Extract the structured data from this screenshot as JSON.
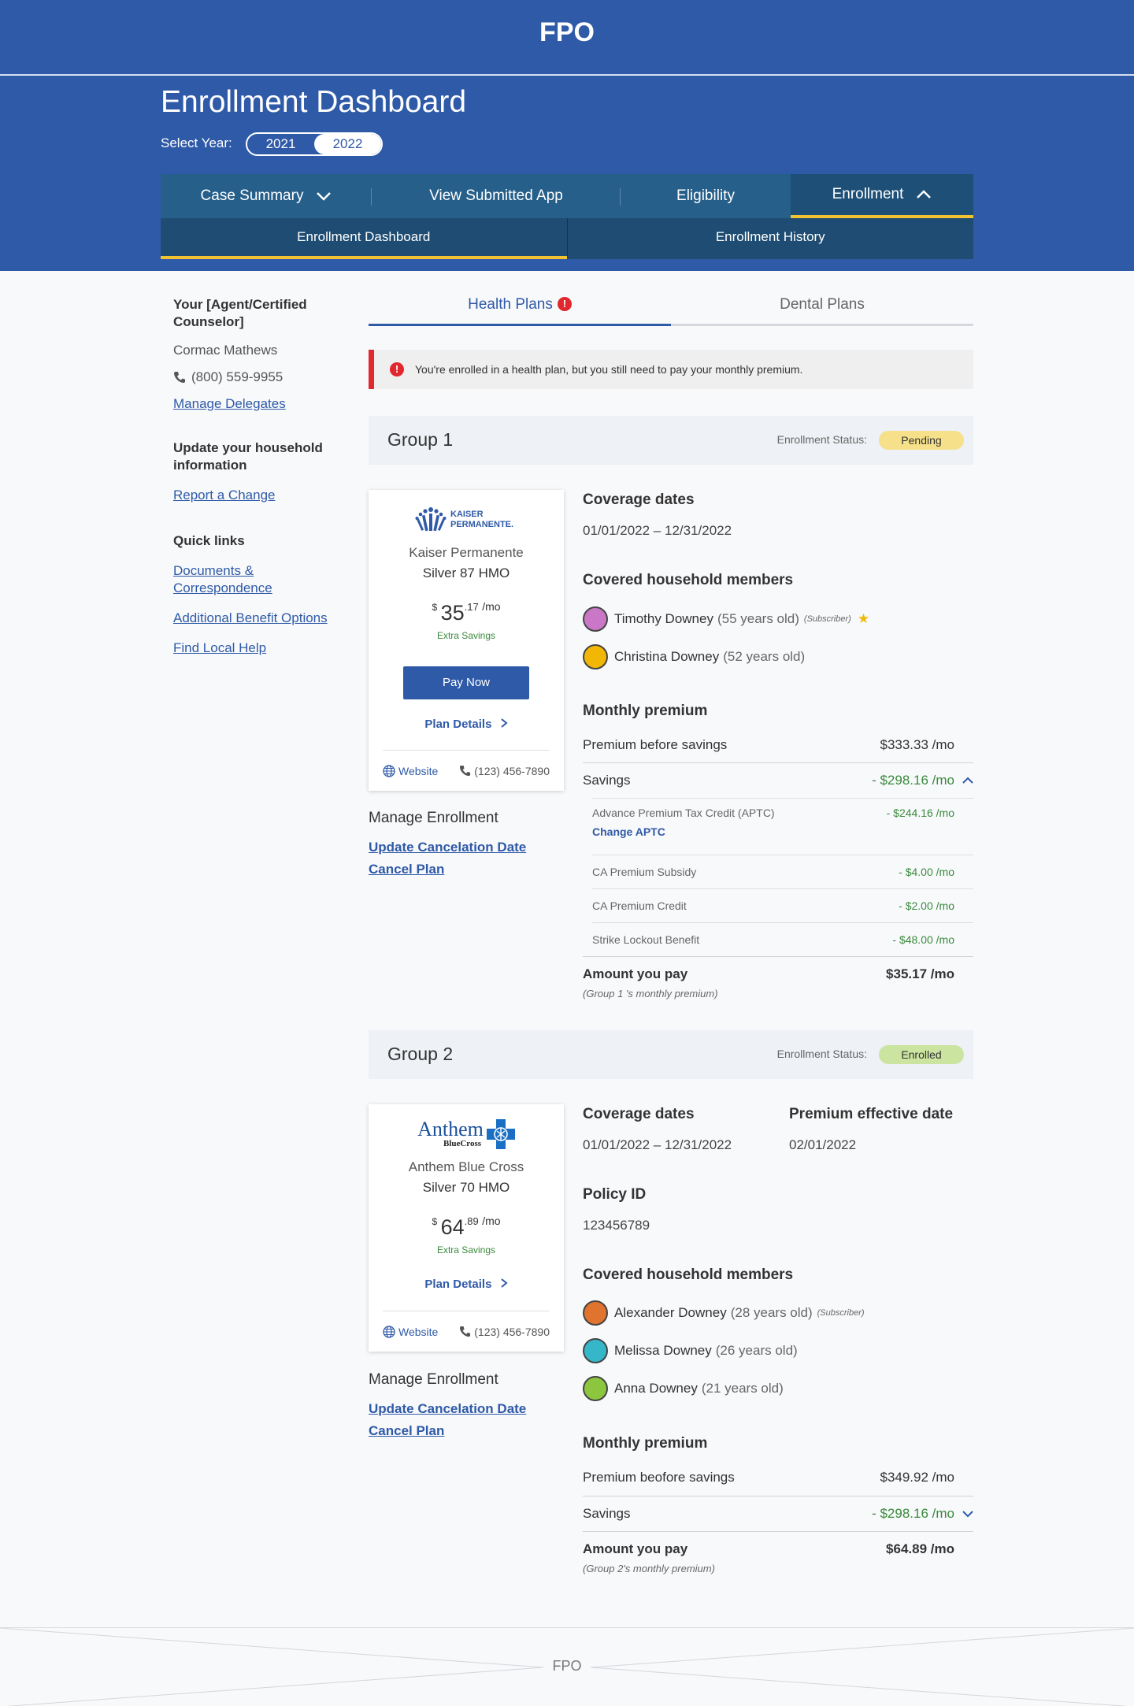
{
  "header": {
    "fpo": "FPO"
  },
  "dashboard": {
    "title": "Enrollment Dashboard",
    "year_label": "Select Year:",
    "years": [
      "2021",
      "2022"
    ],
    "selected_year": "2022"
  },
  "main_nav": [
    {
      "label": "Case Summary"
    },
    {
      "label": "View Submitted App"
    },
    {
      "label": "Eligibility"
    },
    {
      "label": "Enrollment"
    }
  ],
  "sub_nav": [
    {
      "label": "Enrollment Dashboard"
    },
    {
      "label": "Enrollment History"
    }
  ],
  "sidebar": {
    "agent_heading": "Your [Agent/Certified Counselor]",
    "agent_name": "Cormac Mathews",
    "agent_phone": "(800) 559-9955",
    "manage_delegates": "Manage Delegates",
    "household_heading": "Update your household information",
    "report_change": "Report a Change",
    "quick_links_heading": "Quick links",
    "quick_links": [
      "Documents & Correspondence",
      "Additional Benefit Options",
      "Find Local Help"
    ]
  },
  "plan_tabs": [
    {
      "label": "Health Plans",
      "alert": "!"
    },
    {
      "label": "Dental Plans"
    }
  ],
  "alert": {
    "icon": "!",
    "text": "You're enrolled in a health plan, but you still need to pay your monthly premium."
  },
  "groups": [
    {
      "name": "Group 1",
      "status_label": "Enrollment Status:",
      "status": "Pending",
      "status_color": "#f7e08a",
      "card": {
        "logo_text": "KAISER PERMANENTE.",
        "carrier": "Kaiser Permanente",
        "plan": "Silver 87 HMO",
        "currency": "$",
        "price_whole": "35",
        "price_cents": ".17",
        "per": "/mo",
        "savings_label": "Extra Savings",
        "pay_button": "Pay Now",
        "details_link": "Plan Details",
        "website": "Website",
        "phone": "(123) 456-7890"
      },
      "manage_heading": "Manage Enrollment",
      "manage_links": [
        "Update Cancelation Date",
        "Cancel Plan"
      ],
      "coverage_heading": "Coverage dates",
      "coverage_dates": "01/01/2022 – 12/31/2022",
      "members_heading": "Covered household members",
      "members": [
        {
          "name": "Timothy Downey",
          "age": "(55 years old)",
          "tag": "(Subscriber)",
          "avatar": "#c977c6"
        },
        {
          "name": "Christina Downey",
          "age": "(52 years old)",
          "tag": "",
          "avatar": "#f2b705"
        }
      ],
      "premium_heading": "Monthly premium",
      "premium_before_label": "Premium before savings",
      "premium_before": "$333.33 /mo",
      "savings_label": "Savings",
      "savings_total": "- $298.16 /mo",
      "savings_items": [
        {
          "label": "Advance Premium Tax Credit (APTC)",
          "value": "- $244.16 /mo",
          "link": "Change APTC"
        },
        {
          "label": "CA Premium Subsidy",
          "value": "- $4.00 /mo"
        },
        {
          "label": "CA Premium Credit",
          "value": "- $2.00 /mo"
        },
        {
          "label": "Strike Lockout Benefit",
          "value": "- $48.00 /mo"
        }
      ],
      "pay_label": "Amount you pay",
      "pay_value": "$35.17 /mo",
      "pay_sub": "(Group 1 's monthly premium)"
    },
    {
      "name": "Group 2",
      "status_label": "Enrollment Status:",
      "status": "Enrolled",
      "status_color": "#cbe4a0",
      "card": {
        "logo_text": "Anthem",
        "logo_sub": "BlueCross",
        "carrier": "Anthem Blue Cross",
        "plan": "Silver 70 HMO",
        "currency": "$",
        "price_whole": "64",
        "price_cents": ".89",
        "per": "/mo",
        "savings_label": "Extra Savings",
        "details_link": "Plan Details",
        "website": "Website",
        "phone": "(123) 456-7890"
      },
      "manage_heading": "Manage Enrollment",
      "manage_links": [
        "Update Cancelation Date",
        "Cancel Plan"
      ],
      "coverage_heading": "Coverage dates",
      "coverage_dates": "01/01/2022 – 12/31/2022",
      "effective_heading": "Premium effective date",
      "effective_date": "02/01/2022",
      "policy_heading": "Policy ID",
      "policy_id": "123456789",
      "members_heading": "Covered household members",
      "members": [
        {
          "name": "Alexander Downey",
          "age": "(28 years old)",
          "tag": "(Subscriber)",
          "avatar": "#e0742e"
        },
        {
          "name": "Melissa Downey",
          "age": "(26 years old)",
          "tag": "",
          "avatar": "#35b7c9"
        },
        {
          "name": "Anna Downey",
          "age": "(21 years old)",
          "tag": "",
          "avatar": "#8cc63f"
        }
      ],
      "premium_heading": "Monthly premium",
      "premium_before_label": "Premium beofore savings",
      "premium_before": "$349.92 /mo",
      "savings_label": "Savings",
      "savings_total": "- $298.16 /mo",
      "pay_label": "Amount you pay",
      "pay_value": "$64.89 /mo",
      "pay_sub": "(Group 2's monthly premium)"
    }
  ],
  "footer": {
    "fpo": "FPO"
  }
}
